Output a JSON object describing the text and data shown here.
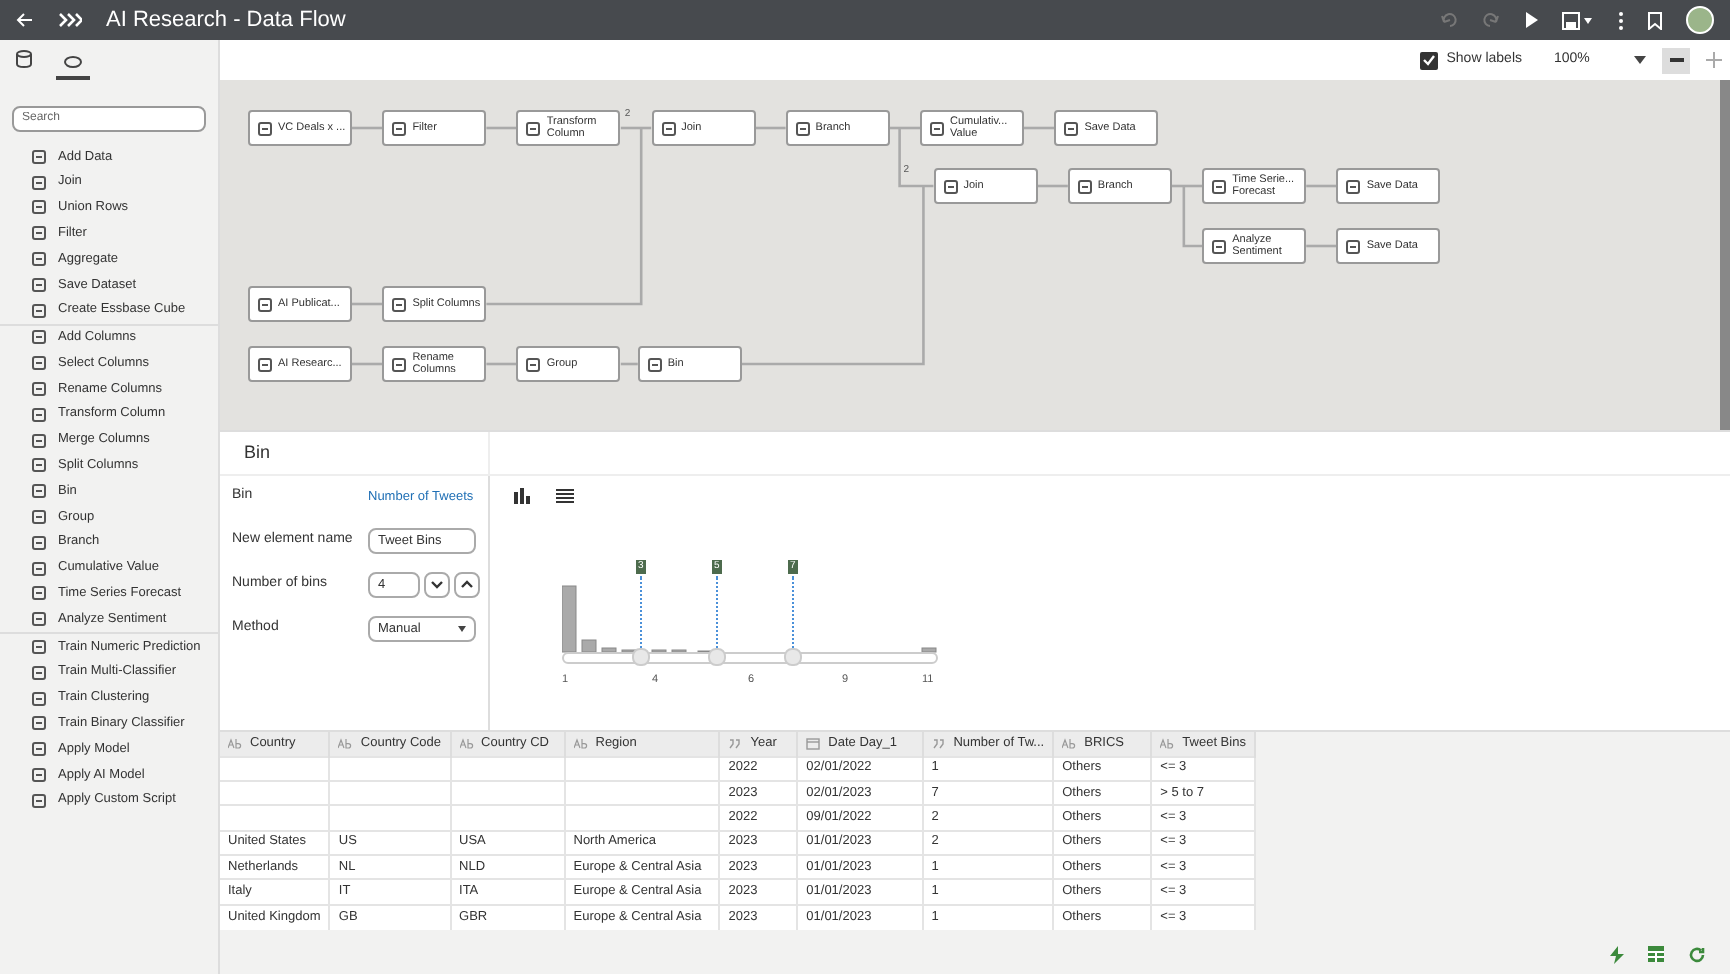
{
  "window": {
    "title": "AI Research - Data Flow"
  },
  "toolbar": {
    "show_labels": {
      "label": "Show labels",
      "checked": true
    },
    "zoom": "100%"
  },
  "sidebar": {
    "search": {
      "placeholder": "Search"
    },
    "groups": [
      [
        "Add Data",
        "Join",
        "Union Rows",
        "Filter",
        "Aggregate",
        "Save Dataset",
        "Create Essbase Cube"
      ],
      [
        "Add Columns",
        "Select Columns",
        "Rename Columns",
        "Transform Column",
        "Merge Columns",
        "Split Columns",
        "Bin",
        "Group",
        "Branch",
        "Cumulative Value",
        "Time Series Forecast",
        "Analyze Sentiment"
      ],
      [
        "Train Numeric Prediction",
        "Train Multi-Classifier",
        "Train Clustering",
        "Train Binary Classifier",
        "Apply Model",
        "Apply AI Model",
        "Apply Custom Script"
      ]
    ]
  },
  "flow": {
    "nodes": [
      {
        "label": "VC Deals x ..."
      },
      {
        "label": "Filter"
      },
      {
        "label": "Transform Column"
      },
      {
        "label": "Join"
      },
      {
        "label": "Branch"
      },
      {
        "label": "Cumulativ... Value"
      },
      {
        "label": "Save Data"
      },
      {
        "label": "Join"
      },
      {
        "label": "Branch"
      },
      {
        "label": "Time Serie... Forecast"
      },
      {
        "label": "Save Data"
      },
      {
        "label": "Analyze Sentiment"
      },
      {
        "label": "Save Data"
      },
      {
        "label": "AI Publicat..."
      },
      {
        "label": "Split Columns"
      },
      {
        "label": "AI Researc..."
      },
      {
        "label": "Rename Columns"
      },
      {
        "label": "Group"
      },
      {
        "label": "Bin"
      }
    ],
    "port_labels": [
      "2",
      "2"
    ]
  },
  "step": {
    "title": "Bin",
    "fields": [
      {
        "kind": "link",
        "label": "Bin",
        "value": "Number of Tweets"
      },
      {
        "kind": "text",
        "label": "New element name",
        "value": "Tweet Bins"
      },
      {
        "kind": "spinner",
        "label": "Number of bins",
        "value": "4"
      },
      {
        "kind": "select",
        "label": "Method",
        "value": "Manual"
      }
    ],
    "histogram": {
      "handles": [
        "3",
        "5",
        "7"
      ],
      "axis_labels": [
        "1",
        "4",
        "6",
        "9",
        "11"
      ]
    }
  },
  "table": {
    "columns": [
      {
        "label": "Country",
        "kind": "text"
      },
      {
        "label": "Country Code",
        "kind": "text"
      },
      {
        "label": "Country CD",
        "kind": "text"
      },
      {
        "label": "Region",
        "kind": "text"
      },
      {
        "label": "Year",
        "kind": "number"
      },
      {
        "label": "Date Day_1",
        "kind": "date"
      },
      {
        "label": "Number of Tw...",
        "kind": "number"
      },
      {
        "label": "BRICS",
        "kind": "text"
      },
      {
        "label": "Tweet Bins",
        "kind": "text"
      }
    ],
    "rows": [
      [
        "",
        "",
        "",
        "",
        "2022",
        "02/01/2022",
        "1",
        "Others",
        "<= 3"
      ],
      [
        "",
        "",
        "",
        "",
        "2023",
        "02/01/2023",
        "7",
        "Others",
        "> 5 to 7"
      ],
      [
        "",
        "",
        "",
        "",
        "2022",
        "09/01/2022",
        "2",
        "Others",
        "<= 3"
      ],
      [
        "United States",
        "US",
        "USA",
        "North America",
        "2023",
        "01/01/2023",
        "2",
        "Others",
        "<= 3"
      ],
      [
        "Netherlands",
        "NL",
        "NLD",
        "Europe & Central Asia",
        "2023",
        "01/01/2023",
        "1",
        "Others",
        "<= 3"
      ],
      [
        "Italy",
        "IT",
        "ITA",
        "Europe & Central Asia",
        "2023",
        "01/01/2023",
        "1",
        "Others",
        "<= 3"
      ],
      [
        "United Kingdom",
        "GB",
        "GBR",
        "Europe & Central Asia",
        "2023",
        "01/01/2023",
        "1",
        "Others",
        "<= 3"
      ]
    ]
  }
}
